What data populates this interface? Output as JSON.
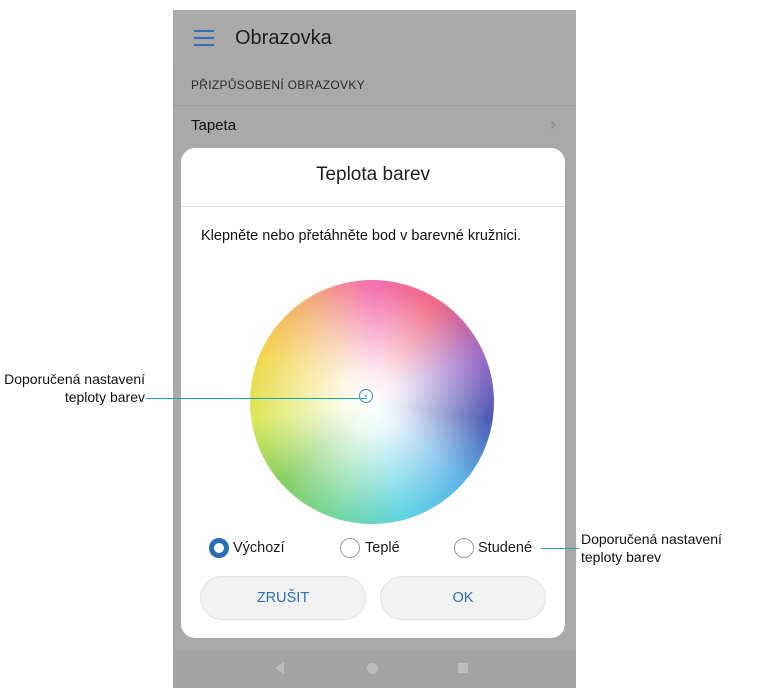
{
  "appbar": {
    "title": "Obrazovka"
  },
  "section": {
    "heading": "PŘIZPŮSOBENÍ OBRAZOVKY"
  },
  "rows": {
    "tapeta": "Tapeta"
  },
  "dialog": {
    "title": "Teplota barev",
    "instruction": "Klepněte nebo přetáhněte bod v barevné kružnici.",
    "options": [
      {
        "label": "Výchozí",
        "selected": true
      },
      {
        "label": "Teplé",
        "selected": false
      },
      {
        "label": "Studené",
        "selected": false
      }
    ],
    "cancel_label": "ZRUŠIT",
    "ok_label": "OK"
  },
  "callouts": {
    "left": "Doporučená nastavení teploty barev",
    "right": "Doporučená nastavení teploty barev"
  },
  "colors": {
    "accent": "#2a6fb5",
    "callout_line": "#1fa2a8"
  },
  "icons": [
    "menu-icon",
    "chevron-right-icon",
    "back-icon",
    "home-icon",
    "recents-icon"
  ]
}
